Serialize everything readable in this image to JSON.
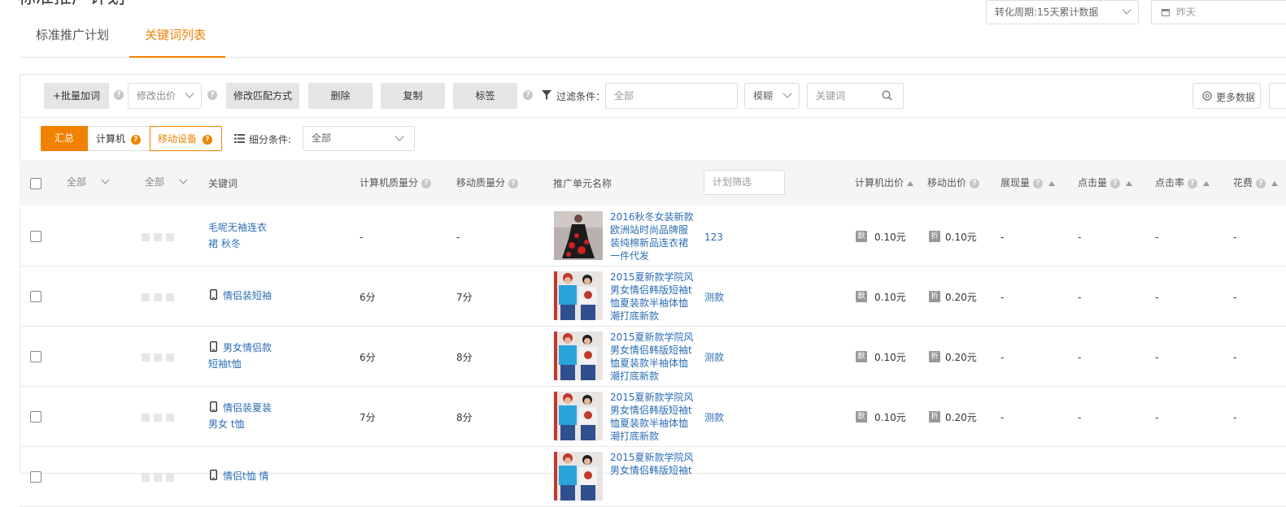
{
  "page": {
    "title": "标准推广计划"
  },
  "header": {
    "conversion_period": "转化周期:15天累计数据",
    "date": "昨天"
  },
  "tabs": [
    {
      "label": "标准推广计划",
      "active": false
    },
    {
      "label": "关键词列表",
      "active": true
    }
  ],
  "toolbar": {
    "batch_add": "+批量加词",
    "modify_bid": "修改出价",
    "modify_match": "修改匹配方式",
    "delete": "删除",
    "copy": "复制",
    "tag": "标签",
    "filter_label": "过滤条件：",
    "filter_value": "全部",
    "match_mode": "模糊",
    "keyword_placeholder": "关键词",
    "more_data": "更多数据"
  },
  "device_tabs": [
    {
      "label": "汇总",
      "active": true
    },
    {
      "label": "计算机",
      "active": false
    },
    {
      "label": "移动设备",
      "active": false
    }
  ],
  "segment": {
    "label": "细分条件:",
    "value": "全部"
  },
  "columns": {
    "filter1": "全部",
    "filter2": "全部",
    "keyword": "关键词",
    "pc_quality": "计算机质量分",
    "mobile_quality": "移动质量分",
    "unit_name": "推广单元名称",
    "plan_filter_placeholder": "计划筛选",
    "pc_bid": "计算机出价",
    "mobile_bid": "移动出价",
    "impressions": "展现量",
    "clicks": "点击量",
    "ctr": "点击率",
    "cost": "花费"
  },
  "badges": {
    "pc": "默",
    "mobile": "折"
  },
  "rows": [
    {
      "keyword1": "毛呢无袖连衣",
      "keyword2": "裙 秋冬",
      "pc_quality": "-",
      "mobile_quality": "-",
      "unit_lines": [
        "2016秋冬女装新款",
        "欧洲站时尚品牌服",
        "装纯棉新品连衣裙",
        "一件代发"
      ],
      "plan": "123",
      "pc_bid": "0.10元",
      "mobile_bid": "0.10元",
      "impressions": "-",
      "clicks": "-",
      "ctr": "-",
      "cost": "-",
      "mobile_icon": false
    },
    {
      "keyword1": "情侣装短袖",
      "keyword2": "",
      "pc_quality": "6分",
      "mobile_quality": "7分",
      "unit_lines": [
        "2015夏新款学院风",
        "男女情侣韩版短袖t",
        "恤夏装款半袖体恤",
        "潮打底新款"
      ],
      "plan": "测款",
      "pc_bid": "0.10元",
      "mobile_bid": "0.20元",
      "impressions": "-",
      "clicks": "-",
      "ctr": "-",
      "cost": "-",
      "mobile_icon": true
    },
    {
      "keyword1": "男女情侣款",
      "keyword2": "短袖t恤",
      "pc_quality": "6分",
      "mobile_quality": "8分",
      "unit_lines": [
        "2015夏新款学院风",
        "男女情侣韩版短袖t",
        "恤夏装款半袖体恤",
        "潮打底新款"
      ],
      "plan": "测款",
      "pc_bid": "0.10元",
      "mobile_bid": "0.20元",
      "impressions": "-",
      "clicks": "-",
      "ctr": "-",
      "cost": "-",
      "mobile_icon": true
    },
    {
      "keyword1": "情侣装夏装",
      "keyword2": "男女 t恤",
      "pc_quality": "7分",
      "mobile_quality": "8分",
      "unit_lines": [
        "2015夏新款学院风",
        "男女情侣韩版短袖t",
        "恤夏装款半袖体恤",
        "潮打底新款"
      ],
      "plan": "测款",
      "pc_bid": "0.10元",
      "mobile_bid": "0.20元",
      "impressions": "-",
      "clicks": "-",
      "ctr": "-",
      "cost": "-",
      "mobile_icon": true
    },
    {
      "keyword1": "情侣t恤 情",
      "keyword2": "",
      "pc_quality": "",
      "mobile_quality": "",
      "unit_lines": [
        "2015夏新款学院风",
        "男女情侣韩版短袖t"
      ],
      "plan": "",
      "pc_bid": "",
      "mobile_bid": "",
      "impressions": "",
      "clicks": "",
      "ctr": "",
      "cost": "",
      "mobile_icon": true
    }
  ]
}
